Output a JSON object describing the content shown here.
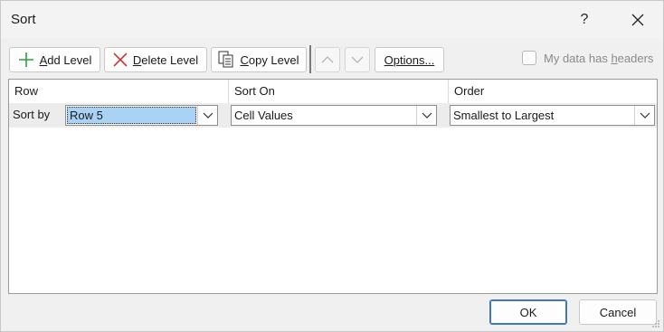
{
  "dialog": {
    "title": "Sort",
    "help_label": "?",
    "close_icon": "close-icon"
  },
  "toolbar": {
    "add_level_prefix": "",
    "add_level_hotkey": "A",
    "add_level_rest": "dd Level",
    "delete_level_hotkey": "D",
    "delete_level_rest": "elete Level",
    "copy_level_hotkey": "C",
    "copy_level_rest": "opy Level",
    "move_up_icon": "chevron-up-icon",
    "move_down_icon": "chevron-down-icon",
    "options_hotkey": "O",
    "options_rest": "ptions...",
    "headers_checkbox_prefix": "My data has ",
    "headers_checkbox_hotkey": "h",
    "headers_checkbox_rest": "eaders",
    "headers_checked": false,
    "accent_add": "#2e9e3e",
    "accent_delete": "#d13438"
  },
  "grid": {
    "columns": [
      "Row",
      "Sort On",
      "Order"
    ],
    "rows": [
      {
        "label": "Sort by",
        "row": "Row 5",
        "sort_on": "Cell Values",
        "order": "Smallest to Largest"
      }
    ]
  },
  "footer": {
    "ok_label": "OK",
    "cancel_label": "Cancel"
  }
}
